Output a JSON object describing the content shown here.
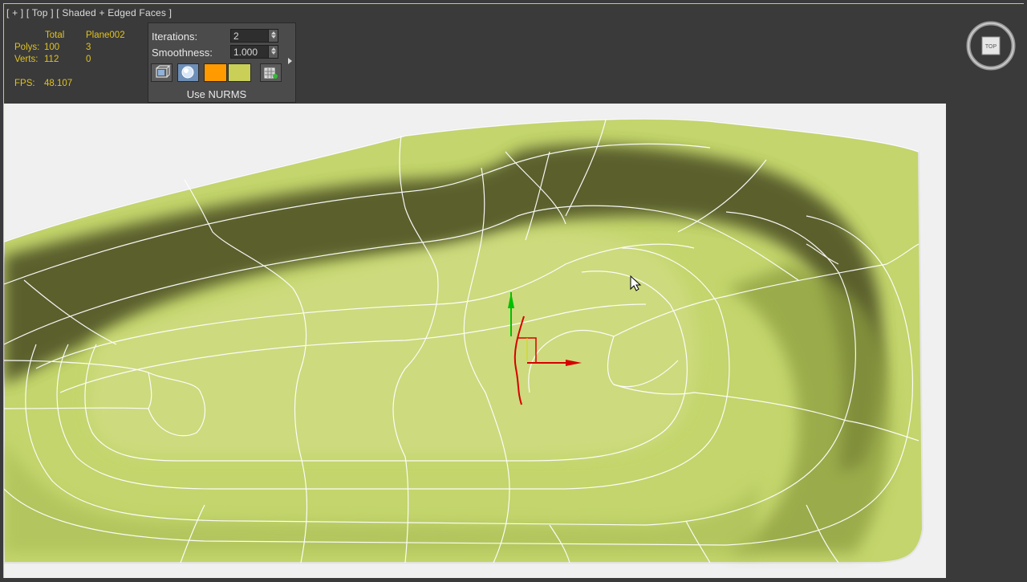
{
  "viewport": {
    "label": "[ + ] [ Top ] [ Shaded + Edged Faces ]"
  },
  "stats": {
    "total_header": "Total",
    "object_header": "Plane002",
    "polys_label": "Polys:",
    "polys_total": "100",
    "polys_object": "3",
    "verts_label": "Verts:",
    "verts_total": "112",
    "verts_object": "0",
    "fps_label": "FPS:",
    "fps_value": "48.107"
  },
  "nurms_panel": {
    "iterations_label": "Iterations:",
    "iterations_value": "2",
    "smoothness_label": "Smoothness:",
    "smoothness_value": "1.000",
    "use_nurms_label": "Use NURMS",
    "swatch_colors": [
      "#ff9b00",
      "#c9cf57"
    ]
  },
  "viewcube": {
    "face_label": "TOP"
  },
  "colors": {
    "surface": "#c1d36b",
    "surface_dark": "#3f4020",
    "wire": "#ffffff",
    "gizmo_x": "#d60000",
    "gizmo_y": "#00c000"
  }
}
